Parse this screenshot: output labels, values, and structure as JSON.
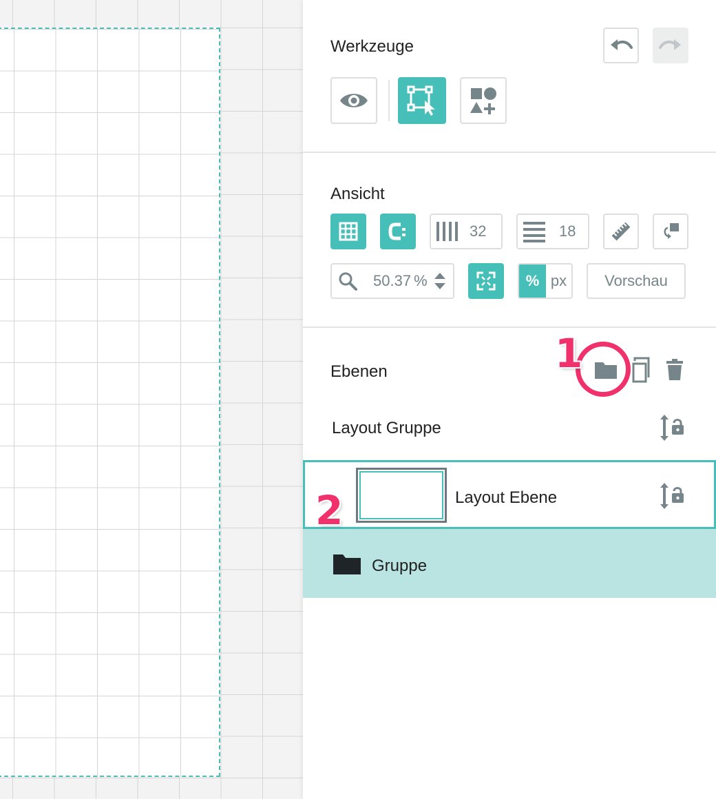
{
  "tools": {
    "title": "Werkzeuge",
    "buttons": [
      {
        "icon": "undo-icon"
      },
      {
        "icon": "redo-icon",
        "disabled": true
      },
      {
        "icon": "eye-icon"
      },
      {
        "icon": "select-transform-icon",
        "active": true
      },
      {
        "icon": "add-shape-icon"
      }
    ]
  },
  "view": {
    "title": "Ansicht",
    "columns_value": "32",
    "rows_value": "18",
    "zoom_value": "50.37",
    "zoom_unit": "%",
    "unit_percent": "%",
    "unit_px": "px",
    "preview_label": "Vorschau"
  },
  "layers": {
    "title": "Ebenen",
    "items": [
      {
        "label": "Layout Gruppe"
      },
      {
        "label": "Layout Ebene",
        "selected": true
      },
      {
        "label": "Gruppe",
        "highlighted": true
      }
    ]
  },
  "annotations": {
    "marker_1": "1",
    "marker_2": "2",
    "color": "#f0316b"
  },
  "colors": {
    "accent": "#47bfb9",
    "highlight_row": "#b9e4e1",
    "icon_gray": "#76858a"
  }
}
